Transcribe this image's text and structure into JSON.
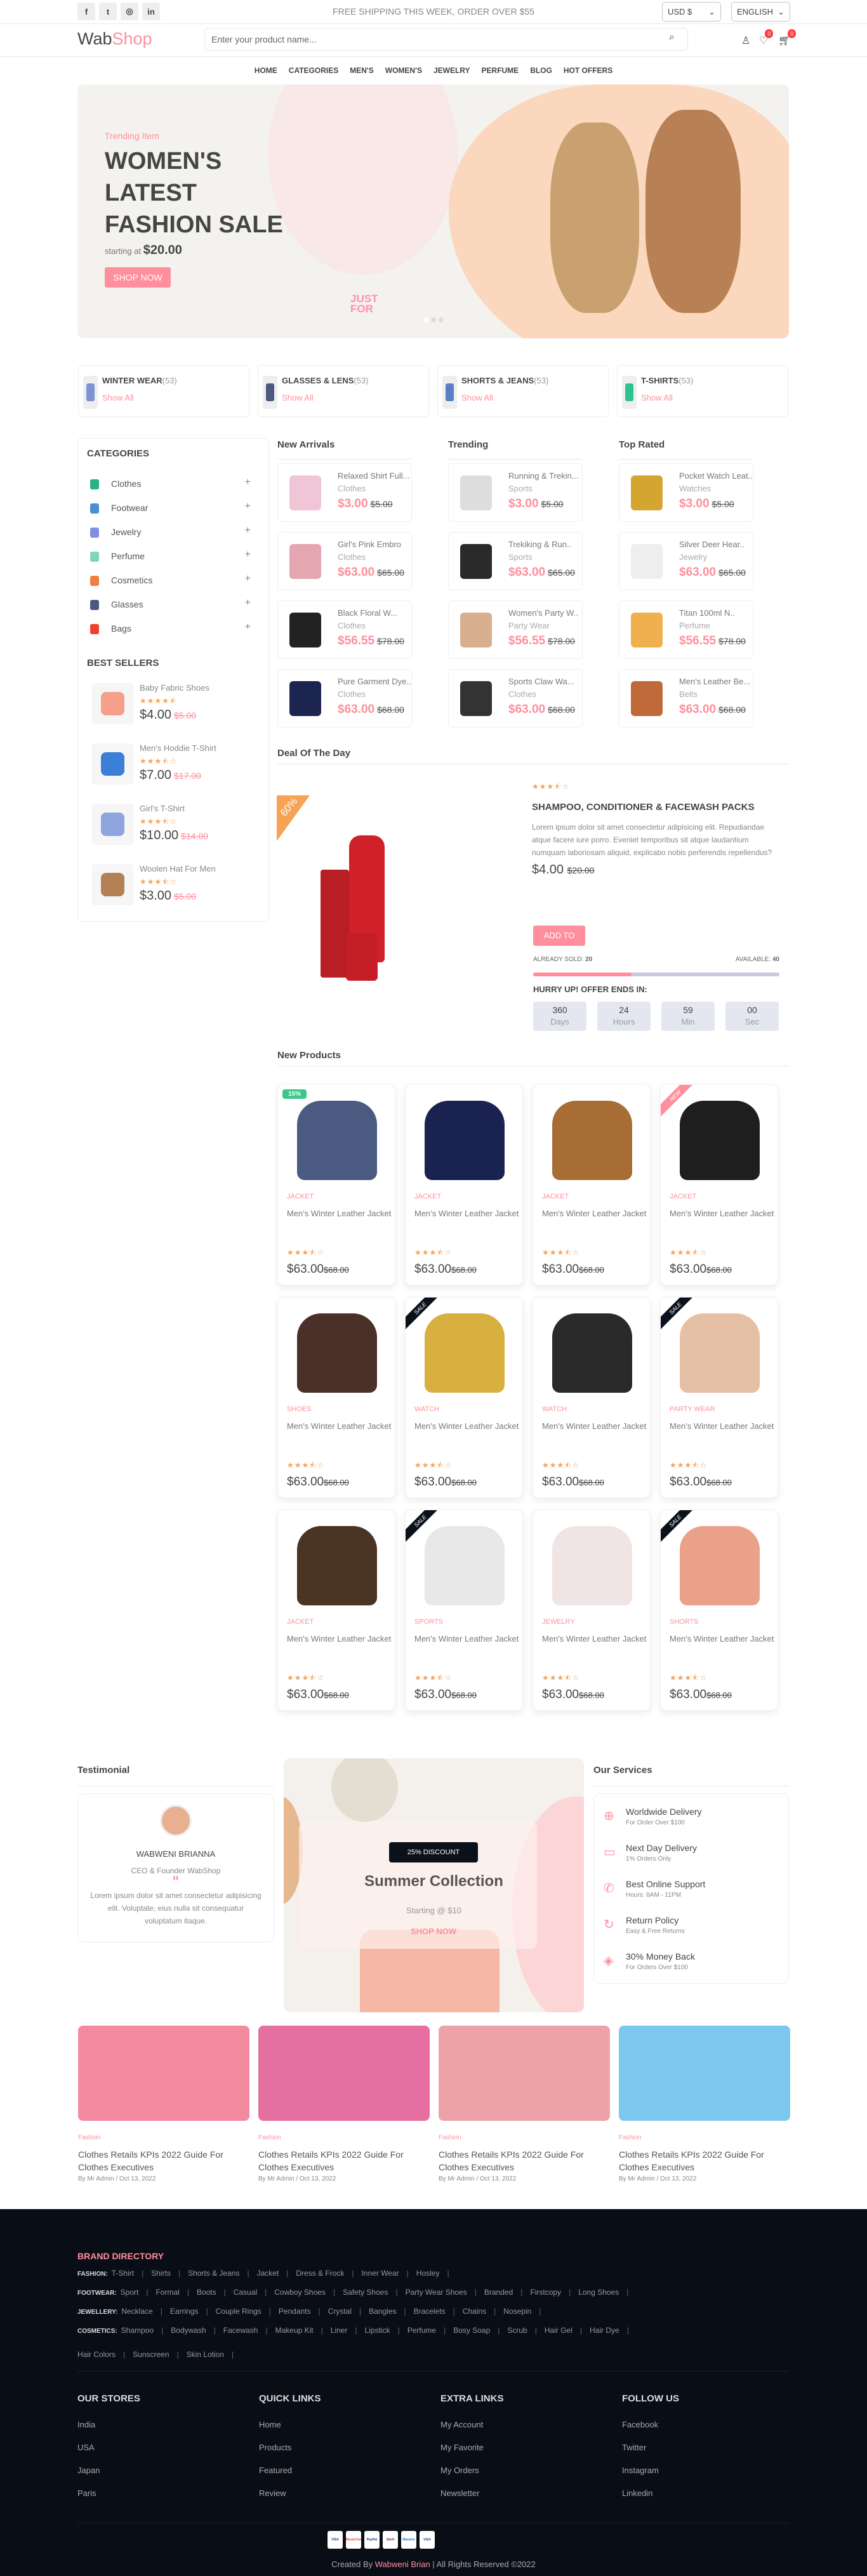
{
  "topbar": {
    "social": [
      {
        "icon": "facebook-icon",
        "glyph": "f"
      },
      {
        "icon": "twitter-icon",
        "glyph": "t"
      },
      {
        "icon": "instagram-icon",
        "glyph": "◎"
      },
      {
        "icon": "linkedin-icon",
        "glyph": "in"
      }
    ],
    "announcement": "FREE SHIPPING THIS WEEK, ORDER OVER $55",
    "currency": "USD $",
    "language": "ENGLISH"
  },
  "header": {
    "logo_a": "Wab",
    "logo_b": "Shop",
    "search_placeholder": "Enter your product name...",
    "wishlist_count": "0",
    "cart_count": "0"
  },
  "nav": [
    "HOME",
    "CATEGORIES",
    "MEN'S",
    "WOMEN'S",
    "JEWELRY",
    "PERFUME",
    "BLOG",
    "HOT OFFERS"
  ],
  "hero": {
    "subtitle": "Trending Item",
    "title1": "WOMEN'S",
    "title2": "LATEST",
    "title3": "FASHION SALE",
    "price_prefix": "starting at",
    "price": "$20.00",
    "cta": "SHOP NOW",
    "stamp": "JUST FOR you"
  },
  "category_cards": [
    {
      "name": "WINTER WEAR",
      "count": "(53)",
      "link": "Show All",
      "color": "#7f93d4"
    },
    {
      "name": "GLASSES & LENS",
      "count": "(53)",
      "link": "Show All",
      "color": "#4d5a80"
    },
    {
      "name": "SHORTS & JEANS",
      "count": "(53)",
      "link": "Show All",
      "color": "#5a7fc9"
    },
    {
      "name": "T-SHIRTS",
      "count": "(53)",
      "link": "Show All",
      "color": "#2bc48f"
    }
  ],
  "sidebar": {
    "title": "CATEGORIES",
    "items": [
      {
        "label": "Clothes",
        "color": "#2bb07f"
      },
      {
        "label": "Footwear",
        "color": "#4a8fd4"
      },
      {
        "label": "Jewelry",
        "color": "#7f8ee0"
      },
      {
        "label": "Perfume",
        "color": "#7fd4c0"
      },
      {
        "label": "Cosmetics",
        "color": "#f08040"
      },
      {
        "label": "Glasses",
        "color": "#4d5a80"
      },
      {
        "label": "Bags",
        "color": "#f04030"
      }
    ],
    "best_title": "BEST SELLERS",
    "best": [
      {
        "name": "Baby Fabric Shoes",
        "rating": 4.5,
        "price": "$4.00",
        "old": "$5.00",
        "color": "#f4a08a"
      },
      {
        "name": "Men's Hoddie T-Shirt",
        "rating": 3.5,
        "price": "$7.00",
        "old": "$17.00",
        "color": "#3b7fd6"
      },
      {
        "name": "Girl's T-Shirt",
        "rating": 3.5,
        "price": "$10.00",
        "old": "$14.00",
        "color": "#8ea6dd"
      },
      {
        "name": "Woolen Hat For Men",
        "rating": 3.5,
        "price": "$3.00",
        "old": "$5.00",
        "color": "#b48055"
      }
    ]
  },
  "lists": [
    {
      "title": "New Arrivals",
      "items": [
        {
          "name": "Relaxed Shirt Full...",
          "cat": "Clothes",
          "price": "$3.00",
          "old": "$5.00",
          "color": "#f0c6d6"
        },
        {
          "name": "Girl's Pink Embro",
          "cat": "Clothes",
          "price": "$63.00",
          "old": "$65.00",
          "color": "#e4a6b0"
        },
        {
          "name": "Black Floral W...",
          "cat": "Clothes",
          "price": "$56.55",
          "old": "$78.00",
          "color": "#222"
        },
        {
          "name": "Pure Garment Dye..",
          "cat": "Clothes",
          "price": "$63.00",
          "old": "$68.00",
          "color": "#1c2450"
        }
      ]
    },
    {
      "title": "Trending",
      "items": [
        {
          "name": "Running & Trekin...",
          "cat": "Sports",
          "price": "$3.00",
          "old": "$5.00",
          "color": "#ddd"
        },
        {
          "name": "Trekiking & Run..",
          "cat": "Sports",
          "price": "$63.00",
          "old": "$65.00",
          "color": "#2a2a2a"
        },
        {
          "name": "Women's Party W..",
          "cat": "Party Wear",
          "price": "$56.55",
          "old": "$78.00",
          "color": "#d8b090"
        },
        {
          "name": "Sports Claw Wa...",
          "cat": "Clothes",
          "price": "$63.00",
          "old": "$68.00",
          "color": "#333"
        }
      ]
    },
    {
      "title": "Top Rated",
      "items": [
        {
          "name": "Pocket Watch Leat..",
          "cat": "Watches",
          "price": "$3.00",
          "old": "$5.00",
          "color": "#d4a530"
        },
        {
          "name": "Silver Deer Hear..",
          "cat": "Jewelry",
          "price": "$63.00",
          "old": "$65.00",
          "color": "#eee"
        },
        {
          "name": "Titan 100ml N..",
          "cat": "Perfume",
          "price": "$56.55",
          "old": "$78.00",
          "color": "#f0b050"
        },
        {
          "name": "Men's Leather Be...",
          "cat": "Belts",
          "price": "$63.00",
          "old": "$68.00",
          "color": "#c06a3a"
        }
      ]
    }
  ],
  "deal": {
    "title": "Deal Of The Day",
    "discount": "60%",
    "rating": 3.5,
    "name": "SHAMPOO, CONDITIONER & FACEWASH PACKS",
    "desc": "Lorem ipsum dolor sit amet consectetur adipisicing elit. Repudiandae atque facere iure porro. Eveniet temporibus sit atque laudantium numquam laboriosam aliquid, explicabo nobis perferendis repellendus?",
    "price": "$4.00",
    "old": "$20.00",
    "cta": "ADD TO CART",
    "sold_label": "ALREADY SOLD:",
    "sold": "20",
    "avail_label": "AVAILABLE:",
    "avail": "40",
    "sold_fraction": 0.4,
    "timer_title": "HURRY UP! OFFER ENDS IN:",
    "timer": [
      {
        "v": "360",
        "u": "Days"
      },
      {
        "v": "24",
        "u": "Hours"
      },
      {
        "v": "59",
        "u": "Min"
      },
      {
        "v": "00",
        "u": "Sec"
      }
    ]
  },
  "new_products": {
    "title": "New Products",
    "items": [
      {
        "cat": "JACKET",
        "name": "Men's Winter Leather Jacket",
        "price": "$63.00",
        "old": "$68.00",
        "rating": 3.5,
        "badge": "15%",
        "badge_type": "percent",
        "color": "#4a5a80"
      },
      {
        "cat": "JACKET",
        "name": "Men's Winter Leather Jacket",
        "price": "$63.00",
        "old": "$68.00",
        "rating": 3.5,
        "badge": "",
        "badge_type": "",
        "color": "#1a2250"
      },
      {
        "cat": "JACKET",
        "name": "Men's Winter Leather Jacket",
        "price": "$63.00",
        "old": "$68.00",
        "rating": 3.5,
        "badge": "",
        "badge_type": "",
        "color": "#a86d35"
      },
      {
        "cat": "JACKET",
        "name": "Men's Winter Leather Jacket",
        "price": "$63.00",
        "old": "$68.00",
        "rating": 3.5,
        "badge": "NEW",
        "badge_type": "new",
        "color": "#1e1e1e"
      },
      {
        "cat": "SHOES",
        "name": "Men's Winter Leather Jacket",
        "price": "$63.00",
        "old": "$68.00",
        "rating": 3.5,
        "badge": "",
        "badge_type": "",
        "color": "#4a3028"
      },
      {
        "cat": "WATCH",
        "name": "Men's Winter Leather Jacket",
        "price": "$63.00",
        "old": "$68.00",
        "rating": 3.5,
        "badge": "SALE",
        "badge_type": "sale",
        "color": "#d8b040"
      },
      {
        "cat": "WATCH",
        "name": "Men's Winter Leather Jacket",
        "price": "$63.00",
        "old": "$68.00",
        "rating": 3.5,
        "badge": "",
        "badge_type": "",
        "color": "#2a2a2a"
      },
      {
        "cat": "PARTY WEAR",
        "name": "Men's Winter Leather Jacket",
        "price": "$63.00",
        "old": "$68.00",
        "rating": 3.5,
        "badge": "SALE",
        "badge_type": "sale",
        "color": "#e6c0a4"
      },
      {
        "cat": "JACKET",
        "name": "Men's Winter Leather Jacket",
        "price": "$63.00",
        "old": "$68.00",
        "rating": 3.5,
        "badge": "",
        "badge_type": "",
        "color": "#4a3424"
      },
      {
        "cat": "SPORTS",
        "name": "Men's Winter Leather Jacket",
        "price": "$63.00",
        "old": "$68.00",
        "rating": 3.5,
        "badge": "SALE",
        "badge_type": "sale",
        "color": "#e8e8e8"
      },
      {
        "cat": "JEWELRY",
        "name": "Men's Winter Leather Jacket",
        "price": "$63.00",
        "old": "$68.00",
        "rating": 3.5,
        "badge": "",
        "badge_type": "",
        "color": "#f0e4e4"
      },
      {
        "cat": "SHORTS",
        "name": "Men's Winter Leather Jacket",
        "price": "$63.00",
        "old": "$68.00",
        "rating": 3.5,
        "badge": "SALE",
        "badge_type": "sale",
        "color": "#eba08a"
      }
    ]
  },
  "testimonial": {
    "title": "Testimonial",
    "name": "WABWENI BRIANNA",
    "role": "CEO & Founder WabShop",
    "quote": "Lorem ipsum dolor sit amet consectetur adipisicing elit. Voluptate, eius nulla sit consequatur voluptatum itaque."
  },
  "banner": {
    "badge": "25% DISCOUNT",
    "title": "Summer Collection",
    "sub": "Starting @ $10",
    "cta": "SHOP NOW"
  },
  "services": {
    "title": "Our Services",
    "items": [
      {
        "icon": "globe-icon",
        "glyph": "⊕",
        "t": "Worldwide Delivery",
        "s": "For Order Over $100"
      },
      {
        "icon": "calendar-icon",
        "glyph": "▭",
        "t": "Next Day Delivery",
        "s": "1% Orders Only"
      },
      {
        "icon": "phone-icon",
        "glyph": "✆",
        "t": "Best Online Support",
        "s": "Hours: 8AM - 11PM"
      },
      {
        "icon": "refresh-icon",
        "glyph": "↻",
        "t": "Return Policy",
        "s": "Easy & Free Returns"
      },
      {
        "icon": "layers-icon",
        "glyph": "◈",
        "t": "30% Money Back",
        "s": "For Orders Over $100"
      }
    ]
  },
  "blogs": [
    {
      "cat": "Fashion",
      "title": "Clothes Retails KPIs 2022 Guide For Clothes Executives",
      "meta": "By Mr Admin / Oct 13, 2022",
      "color": "#f48aa0"
    },
    {
      "cat": "Fashion",
      "title": "Clothes Retails KPIs 2022 Guide For Clothes Executives",
      "meta": "By Mr Admin / Oct 13, 2022",
      "color": "#e46fa0"
    },
    {
      "cat": "Fashion",
      "title": "Clothes Retails KPIs 2022 Guide For Clothes Executives",
      "meta": "By Mr Admin / Oct 13, 2022",
      "color": "#eda2a8"
    },
    {
      "cat": "Fashion",
      "title": "Clothes Retails KPIs 2022 Guide For Clothes Executives",
      "meta": "By Mr Admin / Oct 13, 2022",
      "color": "#7cc8ee"
    }
  ],
  "footer": {
    "brand_title": "BRAND DIRECTORY",
    "directory": [
      {
        "label": "FASHION:",
        "items": [
          "T-Shirt",
          "Shirts",
          "Shorts & Jeans",
          "Jacket",
          "Dress & Frock",
          "Inner Wear",
          "Hosley"
        ]
      },
      {
        "label": "FOOTWEAR:",
        "items": [
          "Sport",
          "Formal",
          "Boots",
          "Casual",
          "Cowboy Shoes",
          "Safety Shoes",
          "Party Wear Shoes",
          "Branded",
          "Firstcopy",
          "Long Shoes"
        ]
      },
      {
        "label": "JEWELLERY:",
        "items": [
          "Necklace",
          "Earrings",
          "Couple Rings",
          "Pendants",
          "Crystal",
          "Bangles",
          "Bracelets",
          "Chains",
          "Nosepin"
        ]
      },
      {
        "label": "COSMETICS:",
        "items": [
          "Shampoo",
          "Bodywash",
          "Facewash",
          "Makeup Kit",
          "Liner",
          "Lipstick",
          "Perfume",
          "Bosy Soap",
          "Scrub",
          "Hair Gel",
          "Hair Dye"
        ]
      },
      {
        "label": "",
        "items": [
          "Hair Colors",
          "Sunscreen",
          "Skin Lotion"
        ]
      }
    ],
    "columns": [
      {
        "title": "OUR STORES",
        "links": [
          "India",
          "USA",
          "Japan",
          "Paris"
        ]
      },
      {
        "title": "QUICK LINKS",
        "links": [
          "Home",
          "Products",
          "Featured",
          "Review"
        ]
      },
      {
        "title": "EXTRA LINKS",
        "links": [
          "My Account",
          "My Favorite",
          "My Orders",
          "Newsletter"
        ]
      },
      {
        "title": "FOLLOW US",
        "links": [
          "Facebook",
          "Twitter",
          "Instagram",
          "Linkedin"
        ]
      }
    ],
    "payments": [
      "VISA",
      "MasterCard",
      "PayPal",
      "Skrill",
      "Maestro",
      "VISA Electron"
    ],
    "copyright_a": "Created By",
    "copyright_author": "Wabweni Brian",
    "copyright_b": "| All Rights Reserved ©2022"
  },
  "colors": {
    "accent": "#ff8f9c",
    "star": "#f6a355",
    "footer_bg": "#090d16",
    "progress_track": "#c8cbe0"
  }
}
